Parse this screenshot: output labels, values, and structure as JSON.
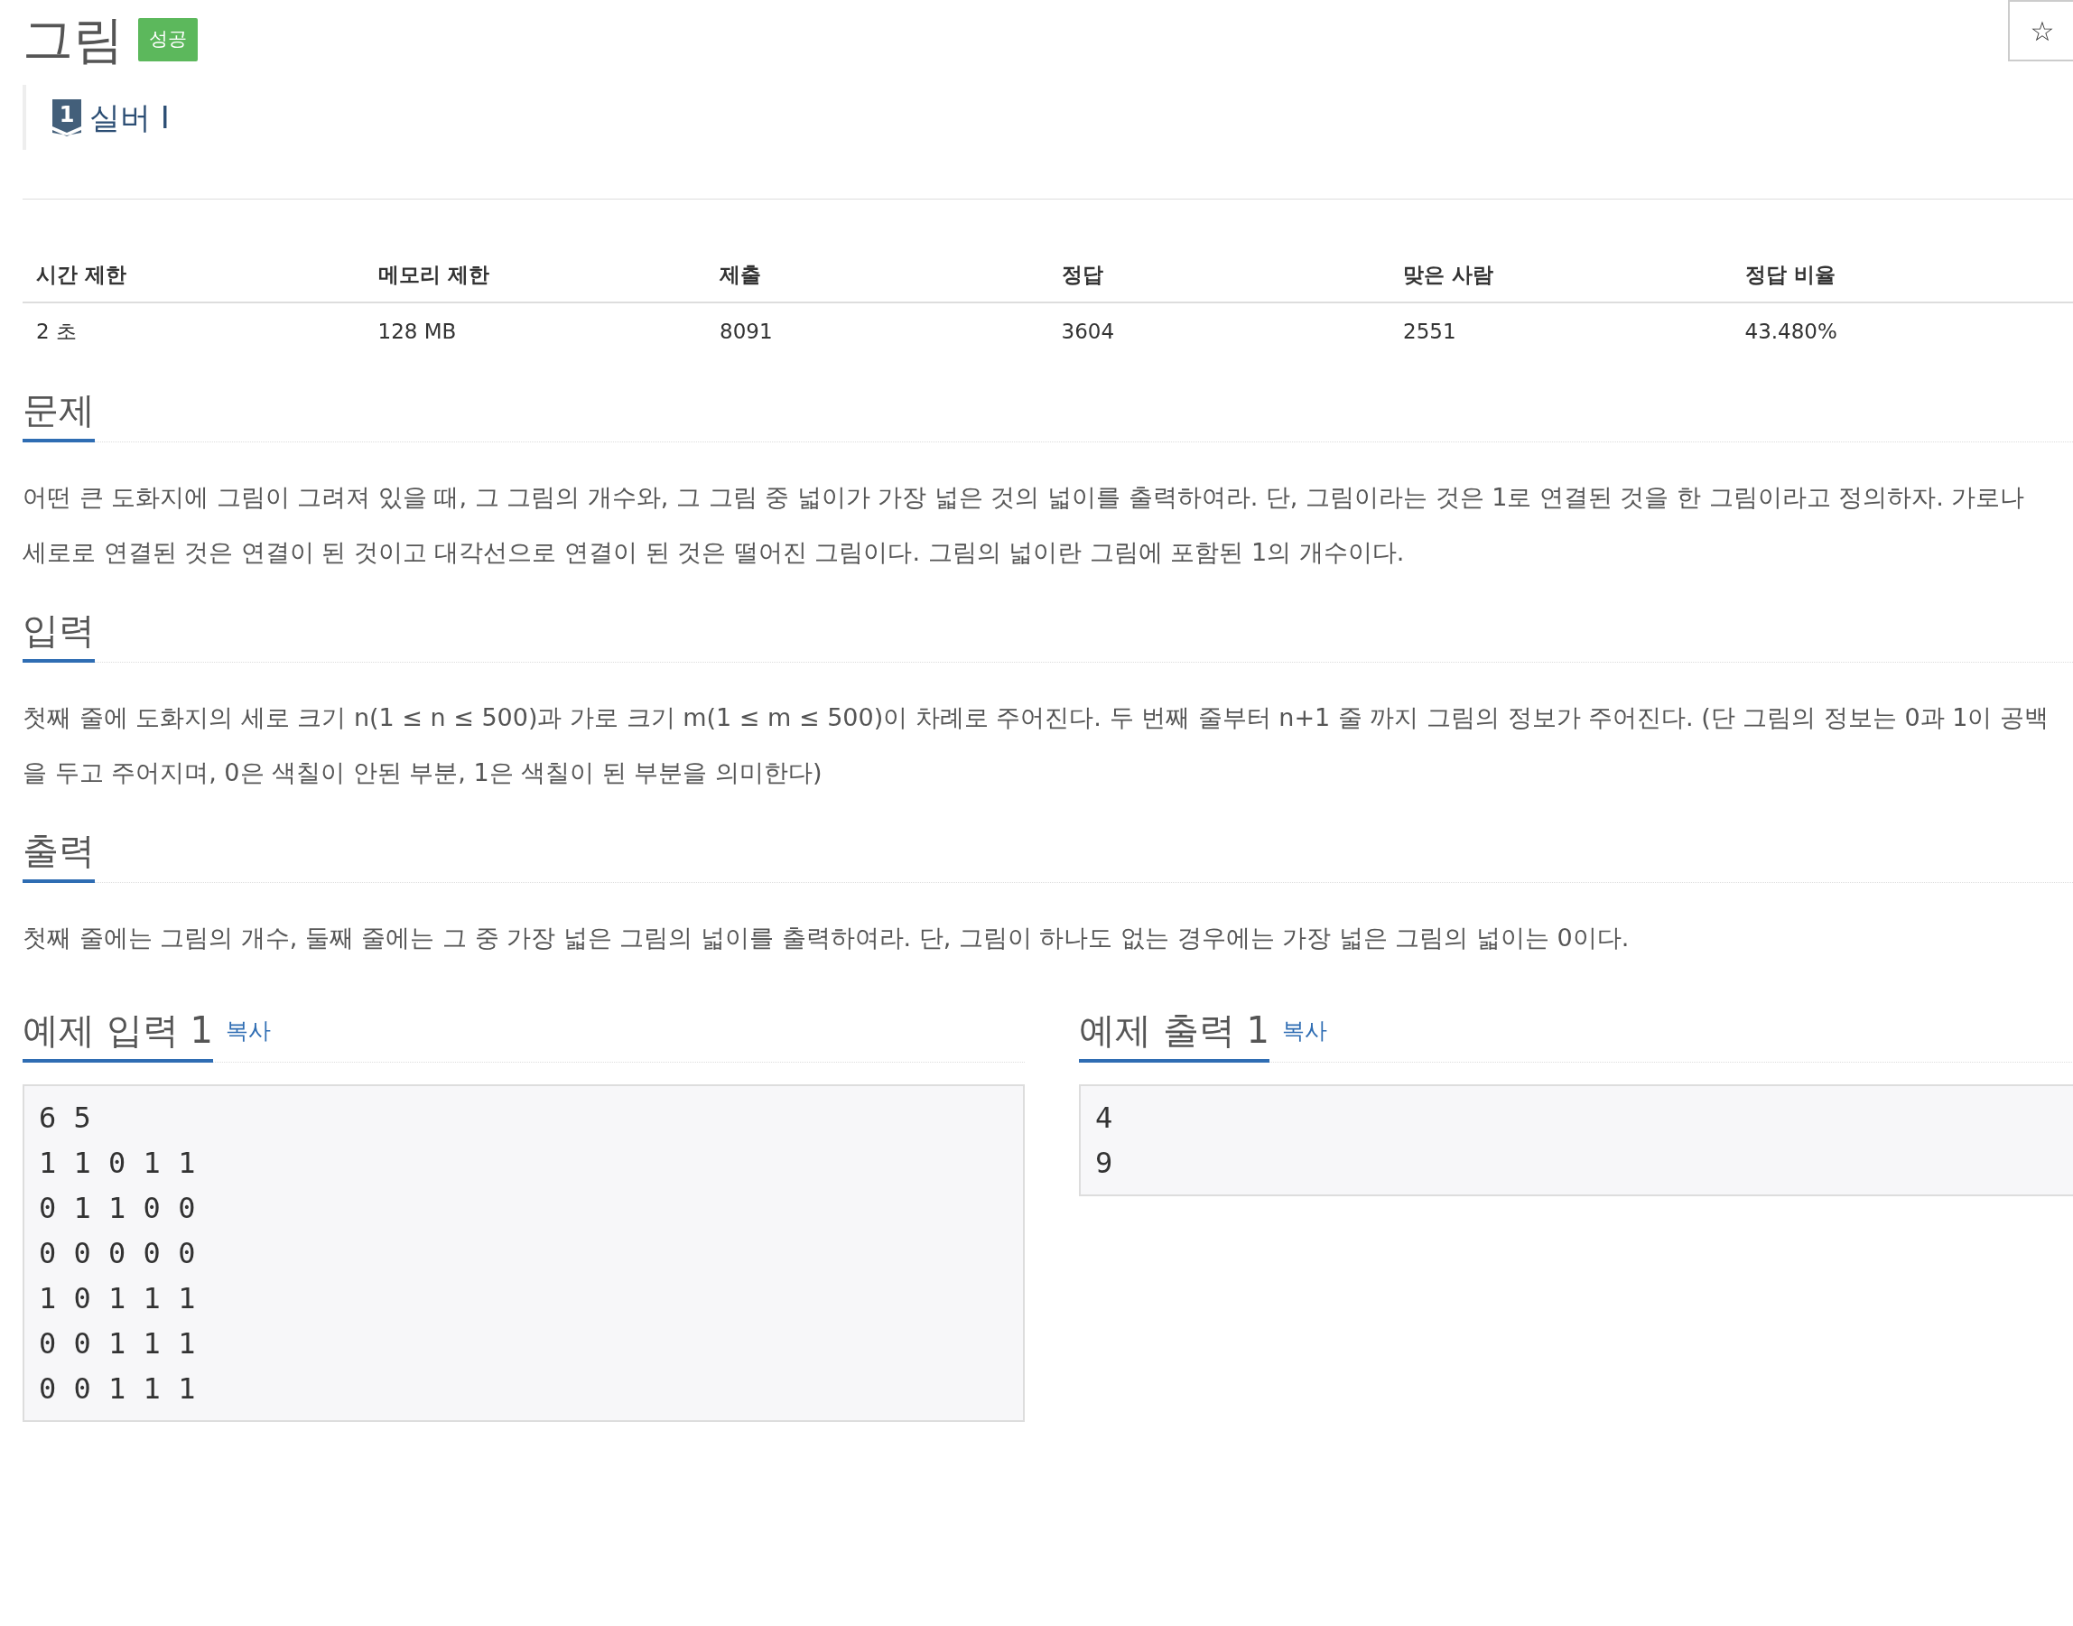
{
  "problem": {
    "title": "그림",
    "result_badge": "성공",
    "tier": {
      "icon_digit": "1",
      "name": "실버 I"
    }
  },
  "favorite_button": {
    "glyph": "☆"
  },
  "info_table": {
    "columns": [
      "시간 제한",
      "메모리 제한",
      "제출",
      "정답",
      "맞은 사람",
      "정답 비율"
    ],
    "rows": [
      [
        "2 초",
        "128 MB",
        "8091",
        "3604",
        "2551",
        "43.480%"
      ]
    ]
  },
  "sections": [
    {
      "heading": "문제",
      "lines": [
        "어떤 큰 도화지에 그림이 그려져 있을 때, 그 그림의 개수와, 그 그림 중 넓이가 가장 넓은 것의 넓이를 출력하여라. 단, 그림이라는 것은 1로 연결된 것을 한 그림이라고 정의하자. 가로나",
        "세로로 연결된 것은 연결이 된 것이고 대각선으로 연결이 된 것은 떨어진 그림이다. 그림의 넓이란 그림에 포함된 1의 개수이다."
      ]
    },
    {
      "heading": "입력",
      "lines": [
        "첫째 줄에 도화지의 세로 크기 n(1 ≤ n ≤ 500)과 가로 크기 m(1 ≤ m ≤ 500)이 차례로 주어진다. 두 번째 줄부터 n+1 줄 까지 그림의 정보가 주어진다. (단 그림의 정보는 0과 1이 공백",
        "을 두고 주어지며, 0은 색칠이 안된 부분, 1은 색칠이 된 부분을 의미한다)"
      ]
    },
    {
      "heading": "출력",
      "lines": [
        "첫째 줄에는 그림의 개수, 둘째 줄에는 그 중 가장 넓은 그림의 넓이를 출력하여라. 단, 그림이 하나도 없는 경우에는 가장 넓은 그림의 넓이는 0이다."
      ]
    }
  ],
  "samples": [
    {
      "heading": "예제 입력 1",
      "copy_link": "복사",
      "content": "6 5\n1 1 0 1 1\n0 1 1 0 0\n0 0 0 0 0\n1 0 1 1 1\n0 0 1 1 1\n0 0 1 1 1"
    },
    {
      "heading": "예제 출력 1",
      "copy_link": "복사",
      "content": "4\n9"
    }
  ]
}
